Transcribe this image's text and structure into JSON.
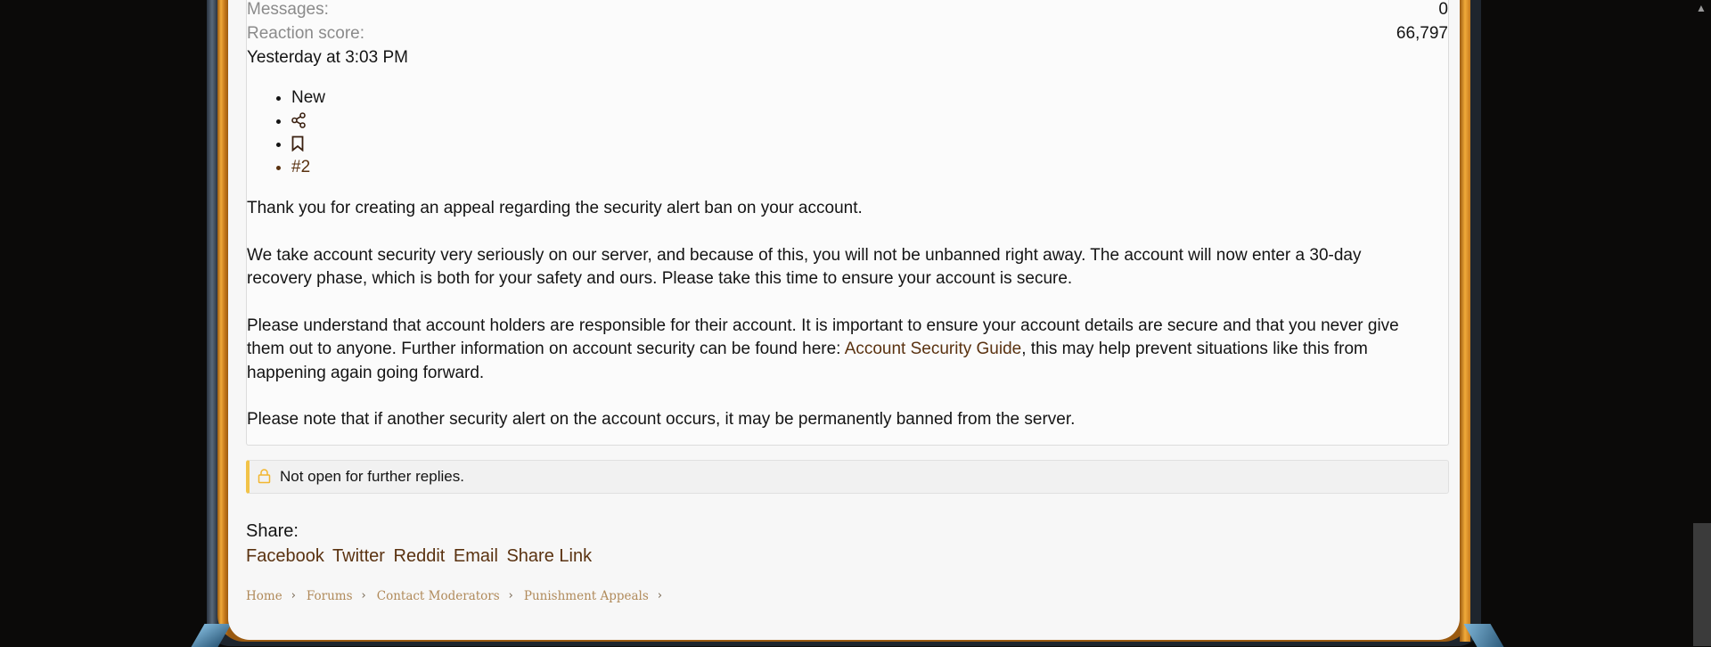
{
  "user_stats": [
    {
      "label": "Messages:",
      "value": "0"
    },
    {
      "label": "Reaction score:",
      "value": "66,797"
    }
  ],
  "post": {
    "date": "Yesterday at 3:03 PM",
    "actions": {
      "new_label": "New",
      "share_icon": "share-icon",
      "bookmark_icon": "bookmark-icon",
      "post_number": "#2"
    },
    "paragraph1": "Thank you for creating an appeal regarding the security alert ban on your account.",
    "paragraph2": "We take account security very seriously on our server, and because of this, you will not be unbanned right away. The account will now enter a 30-day recovery phase, which is both for your safety and ours. Please take this time to ensure your account is secure.",
    "paragraph3_before": "Please understand that account holders are responsible for their account. It is important to ensure your account details are secure and that you never give them out to anyone. Further information on account security can be found here: ",
    "paragraph3_link": "Account Security Guide",
    "paragraph3_after": ", this may help prevent situations like this from happening again going forward.",
    "paragraph4": "Please note that if another security alert on the account occurs, it may be permanently banned from the server."
  },
  "notice": {
    "icon": "lock-icon",
    "text": "Not open for further replies."
  },
  "share": {
    "title": "Share:",
    "links": [
      "Facebook",
      "Twitter",
      "Reddit",
      "Email",
      "Share Link"
    ]
  },
  "breadcrumbs": [
    "Home",
    "Forums",
    "Contact Moderators",
    "Punishment Appeals"
  ],
  "colors": {
    "link": "#5a3210",
    "notice_accent": "#f2c348",
    "frame_gold": "#f0aa3a",
    "breadcrumb": "#b08a5a"
  }
}
